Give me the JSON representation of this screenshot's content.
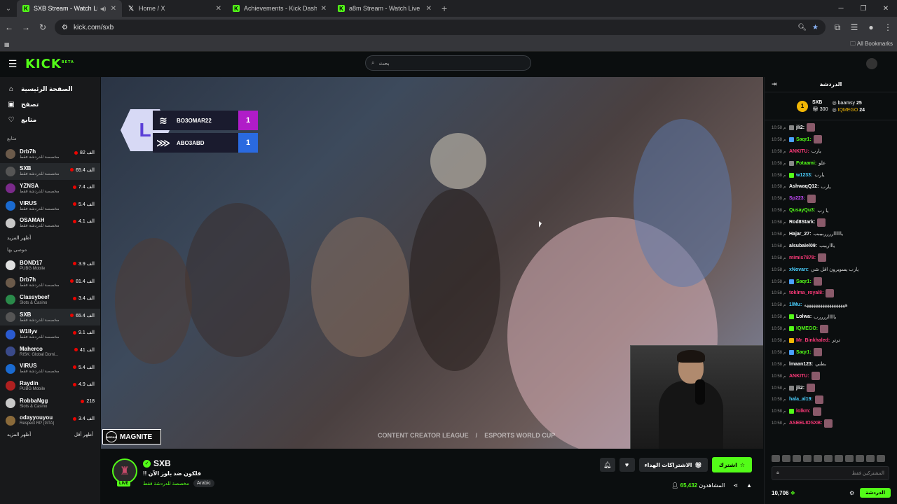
{
  "browser": {
    "tabs": [
      {
        "title": "SXB Stream - Watch Live on",
        "icon": "k",
        "active": true
      },
      {
        "title": "Home / X",
        "icon": "x",
        "active": false
      },
      {
        "title": "Achievements - Kick Dashboard",
        "icon": "k",
        "active": false
      },
      {
        "title": "a8m Stream - Watch Live on K",
        "icon": "k",
        "active": false
      }
    ],
    "url": "kick.com/sxb",
    "all_bookmarks": "All Bookmarks"
  },
  "header": {
    "logo": "KICK",
    "logo_badge": "BETA",
    "search_placeholder": "بحث"
  },
  "sidebar": {
    "nav": [
      {
        "label": "الصفحة الرئيسية",
        "icon": "home-icon"
      },
      {
        "label": "تصفح",
        "icon": "browse-icon"
      },
      {
        "label": "متابع",
        "icon": "heart-icon"
      }
    ],
    "following_title": "متابع",
    "following": [
      {
        "name": "Drb7h",
        "sub": "مخصصة للدردشة فقط",
        "viewers": "82 الف",
        "color": "#6b5a4a"
      },
      {
        "name": "SXB",
        "sub": "مخصصة للدردشة فقط",
        "viewers": "65.4 الف",
        "color": "#555",
        "selected": true
      },
      {
        "name": "YZNSA",
        "sub": "مخصصة للدردشة فقط",
        "viewers": "7.4 الف",
        "color": "#7a2a8a"
      },
      {
        "name": "VIRUS",
        "sub": "مخصصة للدردشة فقط",
        "viewers": "5.4 الف",
        "color": "#1a6ad0"
      },
      {
        "name": "OSAMAH",
        "sub": "مخصصة للدردشة فقط",
        "viewers": "4.1 الف",
        "color": "#c8c8c8"
      }
    ],
    "show_more": "أظهر المزيد",
    "recommended_title": "موصى بها",
    "recommended": [
      {
        "name": "BOND17",
        "sub": "PUBG Mobile",
        "viewers": "3.9 الف",
        "color": "#e0e0e0"
      },
      {
        "name": "Drb7h",
        "sub": "مخصصة للدردشة فقط",
        "viewers": "81.4 الف",
        "color": "#6b5a4a"
      },
      {
        "name": "Classybeef",
        "sub": "Slots & Casino",
        "viewers": "3.4 الف",
        "color": "#2a8a4a"
      },
      {
        "name": "SXB",
        "sub": "مخصصة للدردشة فقط",
        "viewers": "65.4 الف",
        "color": "#555",
        "selected": true
      },
      {
        "name": "W1llyv",
        "sub": "مخصصة للدردشة فقط",
        "viewers": "9.1 الف",
        "color": "#2a5ad0"
      },
      {
        "name": "Maherco",
        "sub": "RISK: Global Domi...",
        "viewers": "41 الف",
        "color": "#3a4a8a"
      },
      {
        "name": "VIRUS",
        "sub": "مخصصة للدردشة فقط",
        "viewers": "5.4 الف",
        "color": "#1a6ad0"
      },
      {
        "name": "Raydin",
        "sub": "PUBG Mobile",
        "viewers": "4.9 الف",
        "color": "#b02020"
      },
      {
        "name": "RobbaNgg",
        "sub": "Slots & Casino",
        "viewers": "218",
        "color": "#c8c8c8"
      },
      {
        "name": "odayyouyou",
        "sub": "Respect RP (GTA)",
        "viewers": "3.4 الف",
        "color": "#8a6a3a"
      }
    ],
    "show_more2": "أظهر المزيد",
    "show_less": "أظهر أقل"
  },
  "video": {
    "scoreboard": [
      {
        "team": "BO3OMAR22",
        "score": "1"
      },
      {
        "team": "ABO3ABD",
        "score": "1"
      }
    ],
    "sponsor": "MAGNITE",
    "sponsor_badge": "NISSAN",
    "watermark_left": "CONTENT CREATOR LEAGUE",
    "watermark_right": "ESPORTS WORLD CUP"
  },
  "stream": {
    "name": "SXB",
    "live": "LIVE",
    "title": "!! فلكون ضد بلوز الآن",
    "category": "مخصصة للدردشة فقط",
    "tag": "Arabic",
    "follow": "اشترك",
    "gift_subs": "الاشتراكات الهداء",
    "viewers_label": "المشاهدون",
    "viewers": "65,432"
  },
  "chat": {
    "title": "الدردشة",
    "leaderboard": {
      "top_name": "SXB",
      "top_rank": "1",
      "top_points": "300",
      "second_name": "baamsy",
      "second_points": "25",
      "third_name": "IQMEGO",
      "third_points": "24"
    },
    "messages": [
      {
        "time": "10:58 م",
        "user": "jli2:",
        "text": "",
        "color": "#ffffff",
        "badge": "#888",
        "emote": true
      },
      {
        "time": "10:58 م",
        "user": "Saqr1:",
        "text": "",
        "color": "#53fc18",
        "badge": "#4aa0ff",
        "emote": true
      },
      {
        "time": "10:58 م",
        "user": "ANKITU:",
        "text": "يارب",
        "color": "#ff3a7a",
        "badge": "",
        "emote": false
      },
      {
        "time": "10:58 م",
        "user": "Fotaami:",
        "text": "علو",
        "color": "#53fc18",
        "badge": "#888",
        "emote": false
      },
      {
        "time": "10:58 م",
        "user": "w1233:",
        "text": "يارب",
        "color": "#4ad0ff",
        "badge": "#53fc18",
        "emote": false
      },
      {
        "time": "10:58 م",
        "user": "AshwaqQ12:",
        "text": "يارب",
        "color": "#ffffff",
        "badge": "",
        "emote": false
      },
      {
        "time": "10:58 م",
        "user": "Sp223:",
        "text": "",
        "color": "#c84aff",
        "badge": "",
        "emote": true
      },
      {
        "time": "10:58 م",
        "user": "QusayQu3:",
        "text": "يا رب",
        "color": "#53fc18",
        "badge": "",
        "emote": false
      },
      {
        "time": "10:58 م",
        "user": "Rod8Stark:",
        "text": "",
        "color": "#ffffff",
        "badge": "",
        "emote": true
      },
      {
        "time": "10:58 م",
        "user": "Hajar_27:",
        "text": "يااااااررررببببب",
        "color": "#ffffff",
        "badge": "",
        "emote": false
      },
      {
        "time": "10:58 م",
        "user": "alsubaiel09:",
        "text": "يااارببب",
        "color": "#ffffff",
        "badge": "",
        "emote": false
      },
      {
        "time": "10:58 م",
        "user": "mimis7878:",
        "text": "",
        "color": "#ff3a7a",
        "badge": "",
        "emote": true
      },
      {
        "time": "10:58 م",
        "user": "xNovarı:",
        "text": "يارب يسويرون اقل شي",
        "color": "#4ad0ff",
        "badge": "",
        "emote": false
      },
      {
        "time": "10:58 م",
        "user": "Saqr1:",
        "text": "",
        "color": "#53fc18",
        "badge": "#4aa0ff",
        "emote": true
      },
      {
        "time": "10:58 م",
        "user": "toklma_royal8:",
        "text": "",
        "color": "#ff3a7a",
        "badge": "",
        "emote": true
      },
      {
        "time": "10:58 م",
        "user": "1lMu:",
        "text": "ههههههههههههههههههه",
        "color": "#4ad0ff",
        "badge": "",
        "emote": false
      },
      {
        "time": "10:58 م",
        "user": "Lolwa:",
        "text": "ياااااررررب",
        "color": "#ffffff",
        "badge": "#53fc18",
        "emote": false
      },
      {
        "time": "10:58 م",
        "user": "IQMEGO:",
        "text": "",
        "color": "#53fc18",
        "badge": "#53fc18",
        "emote": true
      },
      {
        "time": "10:58 م",
        "user": "Mr_Binkhaled:",
        "text": "ترتر",
        "color": "#ff3a7a",
        "badge": "#f2b705",
        "emote": false
      },
      {
        "time": "10:58 م",
        "user": "Saqr1:",
        "text": "",
        "color": "#53fc18",
        "badge": "#4aa0ff",
        "emote": true
      },
      {
        "time": "10:58 م",
        "user": "lmaan123:",
        "text": "بطني",
        "color": "#ffffff",
        "badge": "",
        "emote": false
      },
      {
        "time": "10:58 م",
        "user": "ANKITU:",
        "text": "",
        "color": "#ff3a7a",
        "badge": "",
        "emote": true
      },
      {
        "time": "10:58 م",
        "user": "jli2:",
        "text": "",
        "color": "#ffffff",
        "badge": "#888",
        "emote": true
      },
      {
        "time": "10:58 م",
        "user": "hala_al19:",
        "text": "",
        "color": "#4ad0ff",
        "badge": "",
        "emote": true
      },
      {
        "time": "10:58 م",
        "user": "lolkm:",
        "text": "",
        "color": "#ff3a7a",
        "badge": "#53fc18",
        "emote": true
      },
      {
        "time": "10:58 م",
        "user": "ASEELIOSXB:",
        "text": "",
        "color": "#ff3a7a",
        "badge": "",
        "emote": true
      }
    ],
    "input_placeholder": "المشتركين فقط",
    "send": "الدردشة",
    "points": "10,706"
  }
}
